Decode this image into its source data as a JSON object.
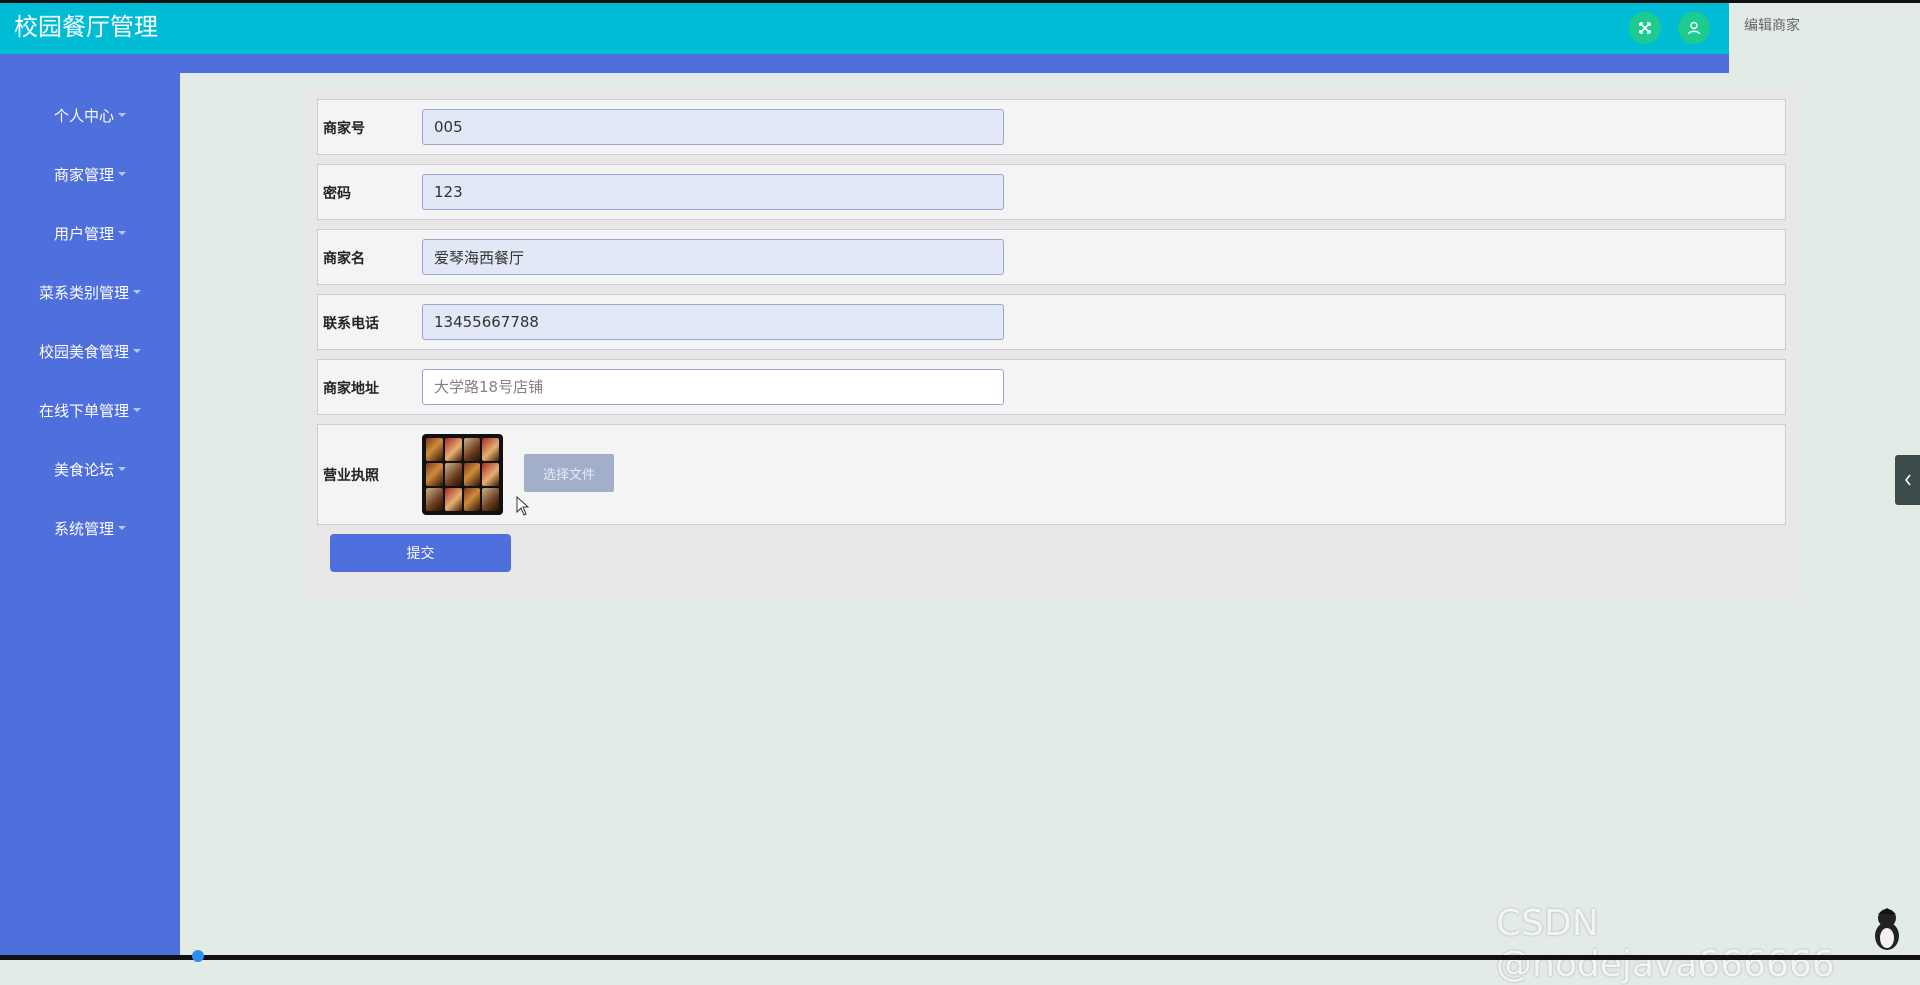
{
  "app": {
    "title": "校园餐厅管理",
    "breadcrumb": "编辑商家"
  },
  "header": {
    "fullscreen_icon": "expand-icon",
    "user_icon": "user-icon",
    "accent_color": "#00bcd4",
    "button_color": "#1ecb8f"
  },
  "sidebar": {
    "items": [
      {
        "label": "个人中心"
      },
      {
        "label": "商家管理"
      },
      {
        "label": "用户管理"
      },
      {
        "label": "菜系类别管理"
      },
      {
        "label": "校园美食管理"
      },
      {
        "label": "在线下单管理"
      },
      {
        "label": "美食论坛"
      },
      {
        "label": "系统管理"
      }
    ],
    "color": "#4e6fdc"
  },
  "form": {
    "merchant_no": {
      "label": "商家号",
      "value": "005"
    },
    "password": {
      "label": "密码",
      "value": "123"
    },
    "merchant_name": {
      "label": "商家名",
      "value": "爱琴海西餐厅"
    },
    "phone": {
      "label": "联系电话",
      "value": "13455667788"
    },
    "address": {
      "label": "商家地址",
      "placeholder": "大学路18号店铺"
    },
    "license": {
      "label": "营业执照",
      "choose_file_label": "选择文件"
    },
    "submit_label": "提交"
  },
  "watermark": "CSDN @nodejava666666"
}
